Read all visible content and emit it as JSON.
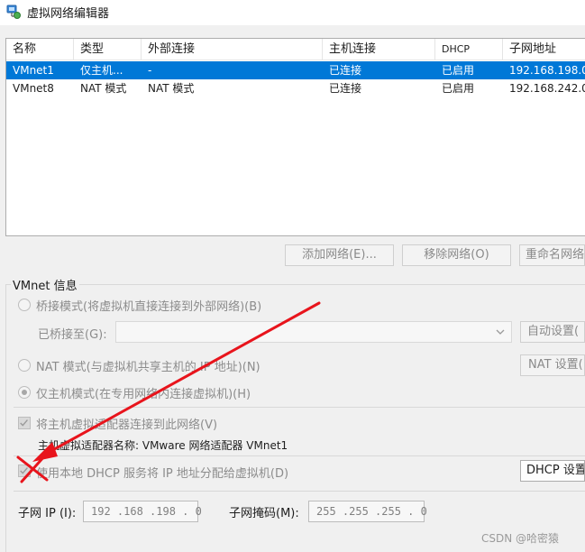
{
  "window": {
    "title": "虚拟网络编辑器"
  },
  "table": {
    "headers": [
      "名称",
      "类型",
      "外部连接",
      "主机连接",
      "DHCP",
      "子网地址"
    ],
    "rows": [
      [
        "VMnet1",
        "仅主机...",
        "-",
        "已连接",
        "已启用",
        "192.168.198.0"
      ],
      [
        "VMnet8",
        "NAT 模式",
        "NAT 模式",
        "已连接",
        "已启用",
        "192.168.242.0"
      ]
    ]
  },
  "actions": {
    "add": "添加网络(E)...",
    "remove": "移除网络(O)",
    "rename": "重命名网络"
  },
  "vmnet_info": {
    "label": "VMnet 信息",
    "bridge_label": "桥接模式(将虚拟机直接连接到外部网络)(B)",
    "bridged_to_label": "已桥接至(G):",
    "bridged_to_value": "",
    "auto_settings": "自动设置(",
    "nat_label": "NAT 模式(与虚拟机共享主机的 IP 地址)(N)",
    "nat_settings": "NAT 设置(",
    "host_only_label": "仅主机模式(在专用网络内连接虚拟机)(H)",
    "selected_mode": "host-only",
    "connect_adapter_label": "将主机虚拟适配器连接到此网络(V)",
    "connect_adapter_checked": true,
    "adapter_name_label": "主机虚拟适配器名称: VMware 网络适配器 VMnet1",
    "dhcp_label": "使用本地 DHCP 服务将 IP 地址分配给虚拟机(D)",
    "dhcp_checked": true,
    "dhcp_settings": "DHCP 设置(",
    "subnet_ip_label": "子网 IP (I):",
    "subnet_ip_value": "192 .168 .198 . 0",
    "subnet_mask_label": "子网掩码(M):",
    "subnet_mask_value": "255 .255 .255 . 0"
  },
  "colors": {
    "selection": "#0078d7",
    "annotation": "#e8141c"
  },
  "watermark": "CSDN @哈密猿"
}
